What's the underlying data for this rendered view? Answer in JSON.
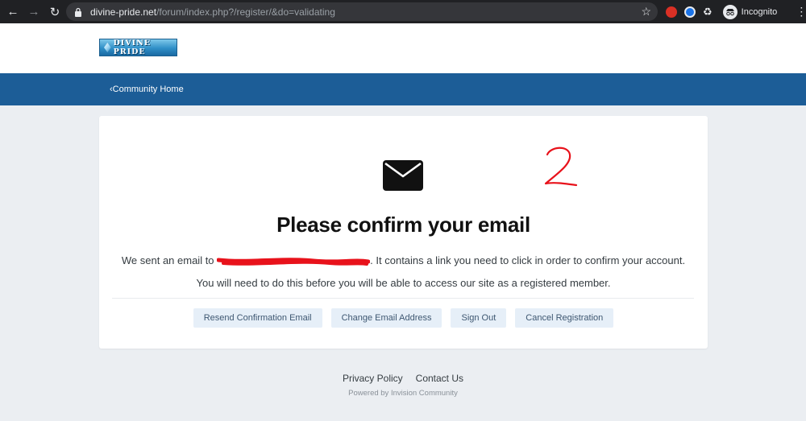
{
  "browser": {
    "url_host": "divine-pride.net",
    "url_path": "/forum/index.php?/register/&do=validating",
    "incognito_label": "Incognito"
  },
  "site": {
    "logo_text": "DIVINE PRIDE",
    "nav_link": "Community Home"
  },
  "card": {
    "icon": "envelope-icon",
    "annotation": "2",
    "title": "Please confirm your email",
    "line1_before": "We sent an email to",
    "line1_after": ". It contains a link you need to click in order to confirm your account.",
    "line2": "You will need to do this before you will be able to access our site as a registered member.",
    "buttons": {
      "resend": "Resend Confirmation Email",
      "change": "Change Email Address",
      "signout": "Sign Out",
      "cancel": "Cancel Registration"
    }
  },
  "footer": {
    "privacy": "Privacy Policy",
    "contact": "Contact Us",
    "powered": "Powered by Invision Community"
  },
  "colors": {
    "navbar": "#1c5d97",
    "page_bg": "#ebeef2",
    "button_bg": "#e6eff8",
    "annotation": "#e8121b"
  }
}
